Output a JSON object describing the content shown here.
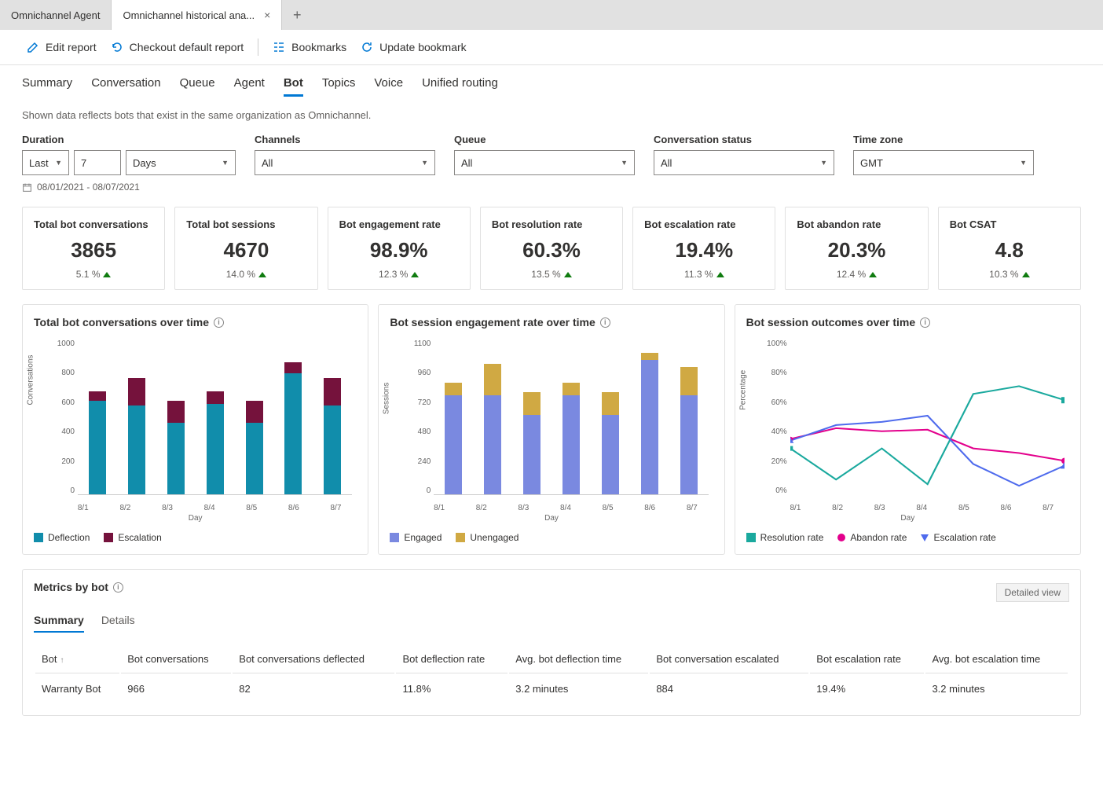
{
  "tabs": {
    "inactive": "Omnichannel Agent",
    "active": "Omnichannel historical ana..."
  },
  "toolbar": {
    "edit": "Edit report",
    "checkout": "Checkout default report",
    "bookmarks": "Bookmarks",
    "update": "Update bookmark"
  },
  "report_tabs": [
    "Summary",
    "Conversation",
    "Queue",
    "Agent",
    "Bot",
    "Topics",
    "Voice",
    "Unified routing"
  ],
  "active_report_tab": "Bot",
  "info": "Shown data reflects bots that exist in the same organization as Omnichannel.",
  "filters": {
    "duration_label": "Duration",
    "duration_prefix": "Last",
    "duration_value": "7",
    "duration_unit": "Days",
    "channels_label": "Channels",
    "channels_value": "All",
    "queue_label": "Queue",
    "queue_value": "All",
    "status_label": "Conversation status",
    "status_value": "All",
    "tz_label": "Time zone",
    "tz_value": "GMT",
    "range": "08/01/2021 - 08/07/2021"
  },
  "kpis": [
    {
      "title": "Total bot conversations",
      "value": "3865",
      "delta": "5.1 %"
    },
    {
      "title": "Total bot sessions",
      "value": "4670",
      "delta": "14.0 %"
    },
    {
      "title": "Bot engagement rate",
      "value": "98.9%",
      "delta": "12.3 %"
    },
    {
      "title": "Bot resolution rate",
      "value": "60.3%",
      "delta": "13.5 %"
    },
    {
      "title": "Bot escalation rate",
      "value": "19.4%",
      "delta": "11.3 %"
    },
    {
      "title": "Bot abandon rate",
      "value": "20.3%",
      "delta": "12.4 %"
    },
    {
      "title": "Bot CSAT",
      "value": "4.8",
      "delta": "10.3 %"
    }
  ],
  "charts_meta": {
    "c1": {
      "title": "Total bot conversations over time",
      "ylabel": "Conversations",
      "xlabel": "Day",
      "legend": [
        "Deflection",
        "Escalation"
      ]
    },
    "c2": {
      "title": "Bot session engagement rate over time",
      "ylabel": "Sessions",
      "xlabel": "Day",
      "legend": [
        "Engaged",
        "Unengaged"
      ]
    },
    "c3": {
      "title": "Bot session outcomes over time",
      "ylabel": "Percentage",
      "xlabel": "Day",
      "legend": [
        "Resolution rate",
        "Abandon rate",
        "Escalation rate"
      ]
    }
  },
  "chart_data": [
    {
      "id": "c1",
      "type": "bar",
      "xlabel": "Day",
      "ylabel": "Conversations",
      "categories": [
        "8/1",
        "8/2",
        "8/3",
        "8/4",
        "8/5",
        "8/6",
        "8/7"
      ],
      "ylim": [
        0,
        1000
      ],
      "yticks": [
        0,
        200,
        400,
        600,
        800,
        1000
      ],
      "series": [
        {
          "name": "Deflection",
          "values": [
            600,
            570,
            460,
            580,
            460,
            780,
            570
          ]
        },
        {
          "name": "Escalation",
          "values": [
            60,
            180,
            140,
            80,
            140,
            70,
            180
          ]
        }
      ]
    },
    {
      "id": "c2",
      "type": "bar",
      "xlabel": "Day",
      "ylabel": "Sessions",
      "categories": [
        "8/1",
        "8/2",
        "8/3",
        "8/4",
        "8/5",
        "8/6",
        "8/7"
      ],
      "ylim": [
        0,
        1100
      ],
      "yticks": [
        0,
        240,
        480,
        720,
        960,
        1100
      ],
      "series": [
        {
          "name": "Engaged",
          "values": [
            700,
            700,
            560,
            700,
            560,
            950,
            700
          ]
        },
        {
          "name": "Unengaged",
          "values": [
            90,
            220,
            160,
            90,
            160,
            50,
            200
          ]
        }
      ]
    },
    {
      "id": "c3",
      "type": "line",
      "xlabel": "Day",
      "ylabel": "Percentage",
      "categories": [
        "8/1",
        "8/2",
        "8/3",
        "8/4",
        "8/5",
        "8/6",
        "8/7"
      ],
      "ylim": [
        0,
        100
      ],
      "yticks": [
        0,
        20,
        40,
        60,
        80,
        100
      ],
      "series": [
        {
          "name": "Resolution rate",
          "values": [
            30,
            10,
            30,
            7,
            65,
            70,
            61
          ]
        },
        {
          "name": "Abandon rate",
          "values": [
            36,
            43,
            41,
            42,
            30,
            27,
            22
          ]
        },
        {
          "name": "Escalation rate",
          "values": [
            35,
            45,
            47,
            51,
            20,
            6,
            19
          ]
        }
      ]
    }
  ],
  "metrics": {
    "title": "Metrics by bot",
    "detailed": "Detailed view",
    "tabs": [
      "Summary",
      "Details"
    ],
    "columns": [
      "Bot",
      "Bot conversations",
      "Bot conversations deflected",
      "Bot deflection rate",
      "Avg. bot deflection time",
      "Bot conversation escalated",
      "Bot escalation rate",
      "Avg. bot escalation time"
    ],
    "rows": [
      {
        "bot": "Warranty Bot",
        "conv": "966",
        "defl": "82",
        "defl_rate": "11.8%",
        "avg_defl": "3.2 minutes",
        "esc": "884",
        "esc_rate": "19.4%",
        "avg_esc": "3.2 minutes"
      }
    ]
  }
}
